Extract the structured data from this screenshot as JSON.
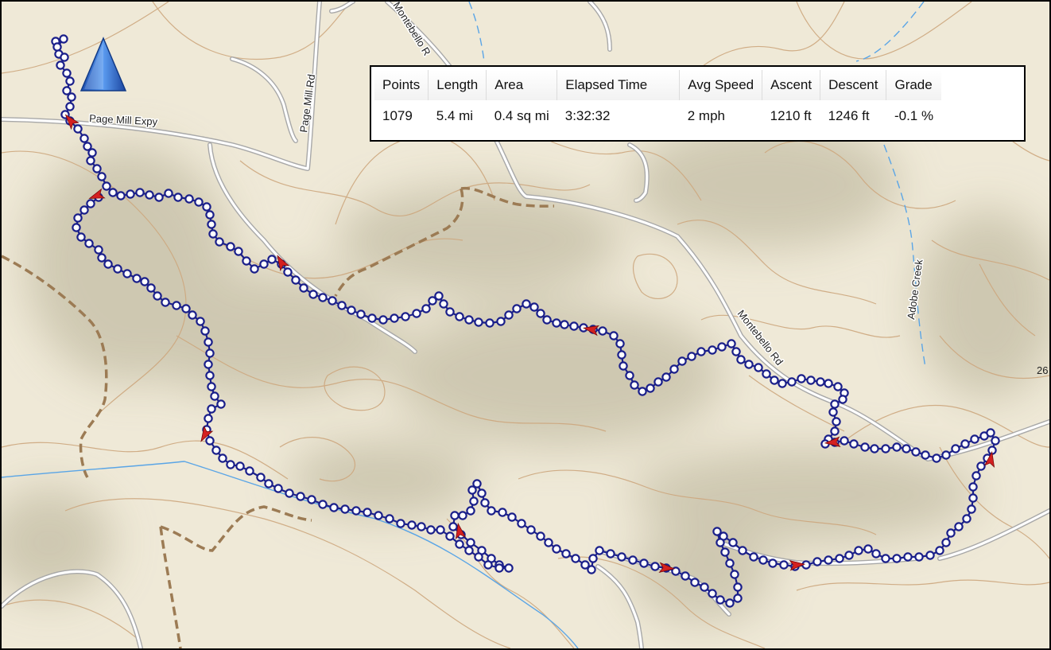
{
  "map": {
    "road_labels": [
      {
        "name": "road-label-page-mill-expy",
        "text": "Page Mill Expy"
      },
      {
        "name": "road-label-page-mill-rd",
        "text": "Page Mill Rd"
      },
      {
        "name": "road-label-montebello-top",
        "text": "Montebello R"
      },
      {
        "name": "road-label-montebello-rd",
        "text": "Montebello Rd"
      },
      {
        "name": "creek-label-adobe",
        "text": "Adobe Creek"
      },
      {
        "name": "edge-label-26",
        "text": "26"
      }
    ],
    "start_marker_icon": "blue-triangle-waypoint-icon",
    "direction_arrow_icon": "red-arrow-icon",
    "colors": {
      "background": "#efe9d7",
      "hill_shade": "#c8c2aa",
      "contour": "#cda77e",
      "road": "#a8a8a8",
      "trail": "#9c7b54",
      "creek": "#5aa5e6",
      "track": "#1a1f8a",
      "arrow": "#d42020",
      "start_marker": "#2f6fd1"
    }
  },
  "stats": {
    "headers": [
      "Points",
      "Length",
      "Area",
      "Elapsed Time",
      "Avg Speed",
      "Ascent",
      "Descent",
      "Grade"
    ],
    "values": [
      "1079",
      "5.4 mi",
      "0.4 sq mi",
      "3:32:32",
      "2 mph",
      "1210 ft",
      "1246 ft",
      "-0.1 %"
    ]
  }
}
